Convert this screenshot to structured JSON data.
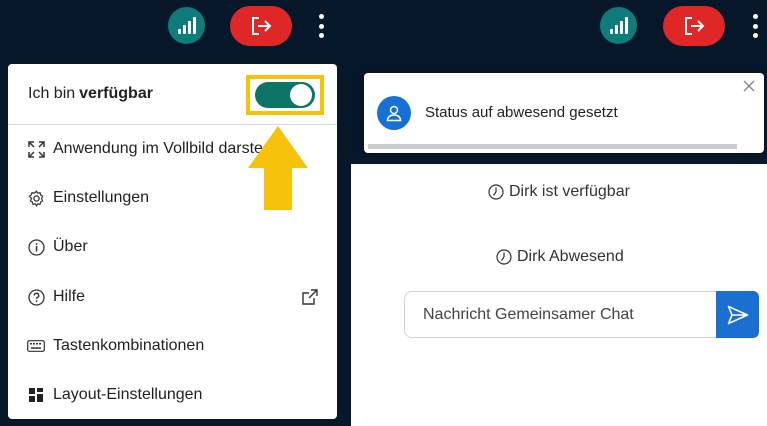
{
  "colors": {
    "background": "#06172a",
    "connection": "#0e7c7b",
    "leave": "#df2727",
    "toggle_on": "#0d7568",
    "highlight": "#f6c20a",
    "accent_blue": "#1671d6"
  },
  "left_panel": {
    "status_prefix": "Ich bin",
    "status_bold": "verfügbar",
    "status_toggle_on": true,
    "items": [
      {
        "label": "Anwendung im Vollbild darste",
        "icon": "fullscreen-icon"
      },
      {
        "label": "Einstellungen",
        "icon": "gear-icon"
      },
      {
        "label": "Über",
        "icon": "info-icon"
      },
      {
        "label": "Hilfe",
        "icon": "help-icon",
        "trailing_icon": "external-link-icon"
      },
      {
        "label": "Tastenkombinationen",
        "icon": "keyboard-icon"
      },
      {
        "label": "Layout-Einstellungen",
        "icon": "layout-icon"
      }
    ]
  },
  "right_panel": {
    "toast_message": "Status auf abwesend gesetzt",
    "system_messages": [
      "Dirk ist verfügbar",
      "Dirk Abwesend"
    ],
    "chat_placeholder": "Nachricht Gemeinsamer Chat"
  }
}
